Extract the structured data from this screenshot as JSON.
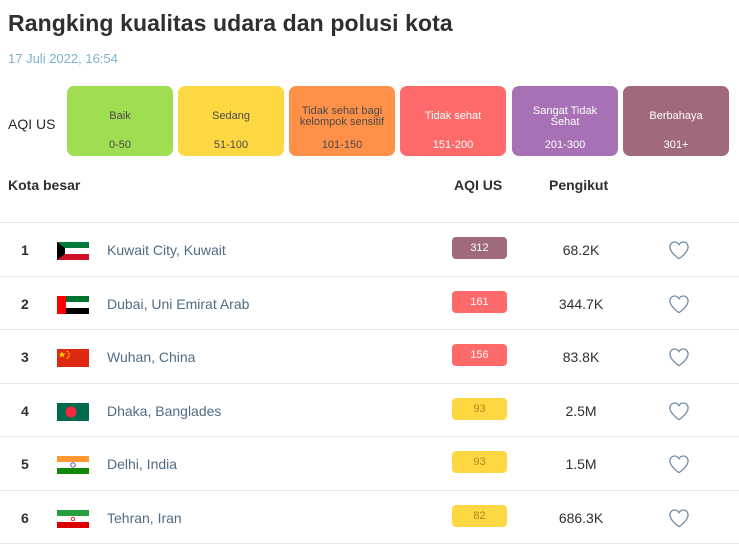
{
  "header": {
    "title": "Rangking kualitas udara dan polusi kota",
    "timestamp": "17 Juli 2022, 16:54"
  },
  "legend": {
    "label": "AQI US",
    "levels": [
      {
        "name": "Baik",
        "range": "0-50",
        "color": "#9fde50"
      },
      {
        "name": "Sedang",
        "range": "51-100",
        "color": "#fed842"
      },
      {
        "name": "Tidak sehat bagi kelompok sensitif",
        "range": "101-150",
        "color": "#fe9048"
      },
      {
        "name": "Tidak sehat",
        "range": "151-200",
        "color": "#fe6a69"
      },
      {
        "name": "Sangat Tidak Sehat",
        "range": "201-300",
        "color": "#a870b5"
      },
      {
        "name": "Berbahaya",
        "range": "301+",
        "color": "#a06a7a"
      }
    ]
  },
  "table": {
    "headers": {
      "city": "Kota besar",
      "aqi": "AQI US",
      "followers": "Pengikut"
    },
    "rows": [
      {
        "rank": "1",
        "city": "Kuwait City, Kuwait",
        "aqi": "312",
        "aqi_color": "#a06a7a",
        "followers": "68.2K",
        "flag": "kuwait-flag-icon"
      },
      {
        "rank": "2",
        "city": "Dubai, Uni Emirat Arab",
        "aqi": "161",
        "aqi_color": "#fe6a69",
        "followers": "344.7K",
        "flag": "uae-flag-icon"
      },
      {
        "rank": "3",
        "city": "Wuhan, China",
        "aqi": "156",
        "aqi_color": "#fe6a69",
        "followers": "83.8K",
        "flag": "china-flag-icon"
      },
      {
        "rank": "4",
        "city": "Dhaka, Banglades",
        "aqi": "93",
        "aqi_color": "#fed842",
        "followers": "2.5M",
        "flag": "bangladesh-flag-icon"
      },
      {
        "rank": "5",
        "city": "Delhi, India",
        "aqi": "93",
        "aqi_color": "#fed842",
        "followers": "1.5M",
        "flag": "india-flag-icon"
      },
      {
        "rank": "6",
        "city": "Tehran, Iran",
        "aqi": "82",
        "aqi_color": "#fed842",
        "followers": "686.3K",
        "flag": "iran-flag-icon"
      }
    ]
  }
}
